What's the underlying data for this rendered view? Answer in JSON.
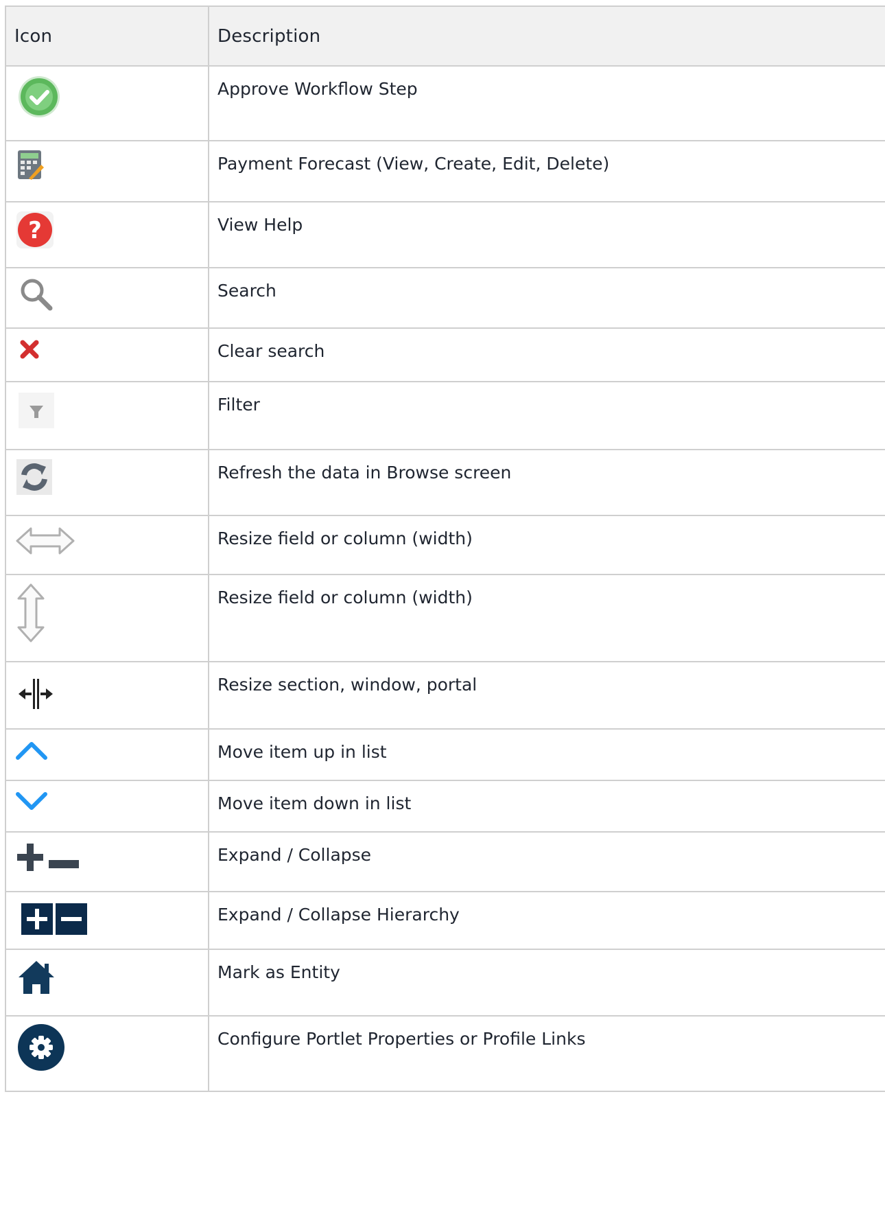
{
  "headers": {
    "icon": "Icon",
    "description": "Description"
  },
  "rows": [
    {
      "icon": "approve-check-icon",
      "description": "Approve Workflow Step"
    },
    {
      "icon": "calculator-icon",
      "description": "Payment Forecast (View, Create, Edit, Delete)"
    },
    {
      "icon": "help-icon",
      "description": "View Help"
    },
    {
      "icon": "search-icon",
      "description": "Search"
    },
    {
      "icon": "clear-search-x-icon",
      "description": "Clear search"
    },
    {
      "icon": "filter-icon",
      "description": "Filter"
    },
    {
      "icon": "refresh-icon",
      "description": "Refresh the data in Browse screen"
    },
    {
      "icon": "horizontal-resize-arrow-icon",
      "description": "Resize field or column (width)"
    },
    {
      "icon": "vertical-resize-arrow-icon",
      "description": "Resize field or column (width)"
    },
    {
      "icon": "split-resize-icon",
      "description": "Resize section, window, portal"
    },
    {
      "icon": "chevron-up-icon",
      "description": "Move item up in list"
    },
    {
      "icon": "chevron-down-icon",
      "description": "Move item down in list"
    },
    {
      "icon": "plus-minus-icon",
      "description": "Expand / Collapse"
    },
    {
      "icon": "plus-minus-boxed-icon",
      "description": "Expand / Collapse Hierarchy"
    },
    {
      "icon": "house-icon",
      "description": "Mark as Entity"
    },
    {
      "icon": "gear-icon",
      "description": "Configure Portlet Properties or Profile Links"
    }
  ]
}
